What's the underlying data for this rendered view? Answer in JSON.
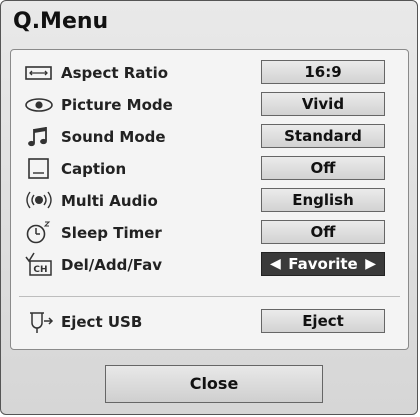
{
  "title": "Q.Menu",
  "items": [
    {
      "label": "Aspect Ratio",
      "value": "16:9",
      "icon": "aspect-ratio-icon"
    },
    {
      "label": "Picture Mode",
      "value": "Vivid",
      "icon": "eye-icon"
    },
    {
      "label": "Sound Mode",
      "value": "Standard",
      "icon": "music-note-icon"
    },
    {
      "label": "Caption",
      "value": "Off",
      "icon": "caption-icon"
    },
    {
      "label": "Multi Audio",
      "value": "English",
      "icon": "multi-audio-icon"
    },
    {
      "label": "Sleep Timer",
      "value": "Off",
      "icon": "sleep-timer-icon"
    },
    {
      "label": "Del/Add/Fav",
      "value": "Favorite",
      "icon": "channel-icon"
    },
    {
      "label": "Eject USB",
      "value": "Eject",
      "icon": "eject-usb-icon"
    }
  ],
  "close_label": "Close",
  "colors": {
    "selected_bg": "#3a3a3a",
    "panel_bg": "#f4f4f4"
  }
}
